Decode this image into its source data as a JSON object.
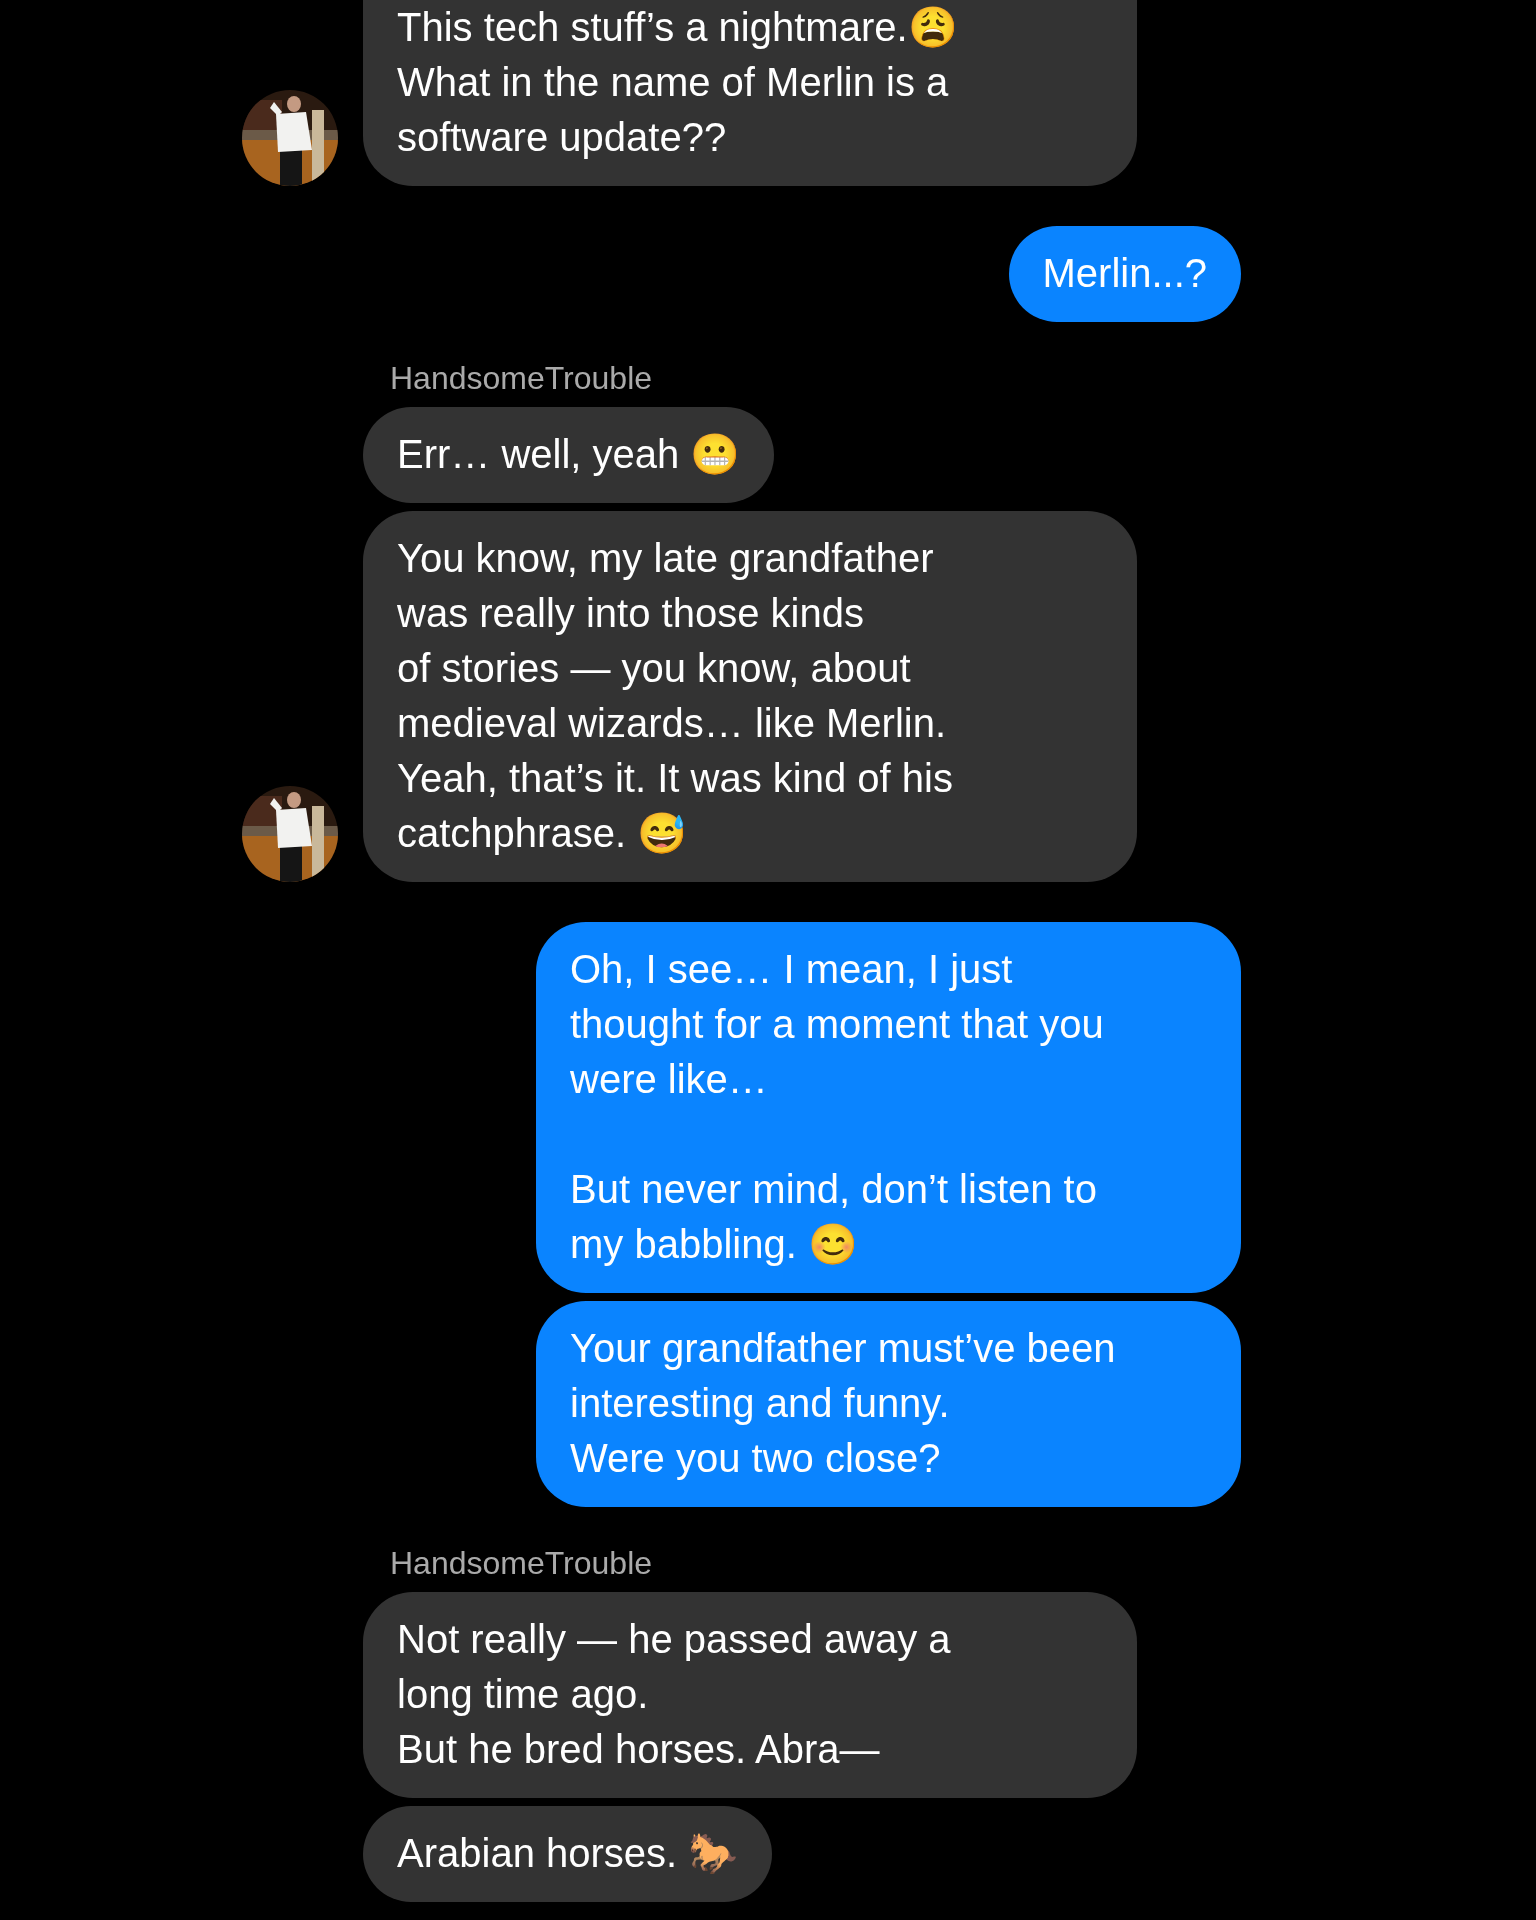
{
  "messages": [
    {
      "kind": "received",
      "text": "This tech stuff’s a nightmare.",
      "emoji": "😩",
      "text2": "What in the name of Merlin is a\nsoftware update??",
      "avatar": true,
      "cut_top": true
    },
    {
      "kind": "sent",
      "text": "Merlin...?"
    },
    {
      "kind": "sender_name",
      "text": "HandsomeTrouble"
    },
    {
      "kind": "received",
      "text": "Err… well, yeah ",
      "emoji": "😬",
      "avatar": false
    },
    {
      "kind": "received",
      "text": "You know, my late grandfather\nwas really into those kinds\nof stories — you know, about\nmedieval wizards… like Merlin.\nYeah, that’s it. It was kind of his\ncatchphrase. ",
      "emoji": "😅",
      "avatar": true
    },
    {
      "kind": "sent",
      "text": "Oh, I see… I mean, I just\nthought for a moment that you\nwere like…\n\nBut never mind, don’t listen to\nmy babbling. ",
      "emoji": "😊"
    },
    {
      "kind": "sent",
      "text": "Your grandfather must’ve been\ninteresting and funny.\nWere you two close?"
    },
    {
      "kind": "sender_name",
      "text": "HandsomeTrouble"
    },
    {
      "kind": "received",
      "text": "Not really — he passed away a\nlong time ago.\nBut he bred horses. Abra—",
      "avatar": false
    },
    {
      "kind": "received",
      "text": "Arabian horses. ",
      "emoji": "🐎",
      "avatar": false
    }
  ]
}
